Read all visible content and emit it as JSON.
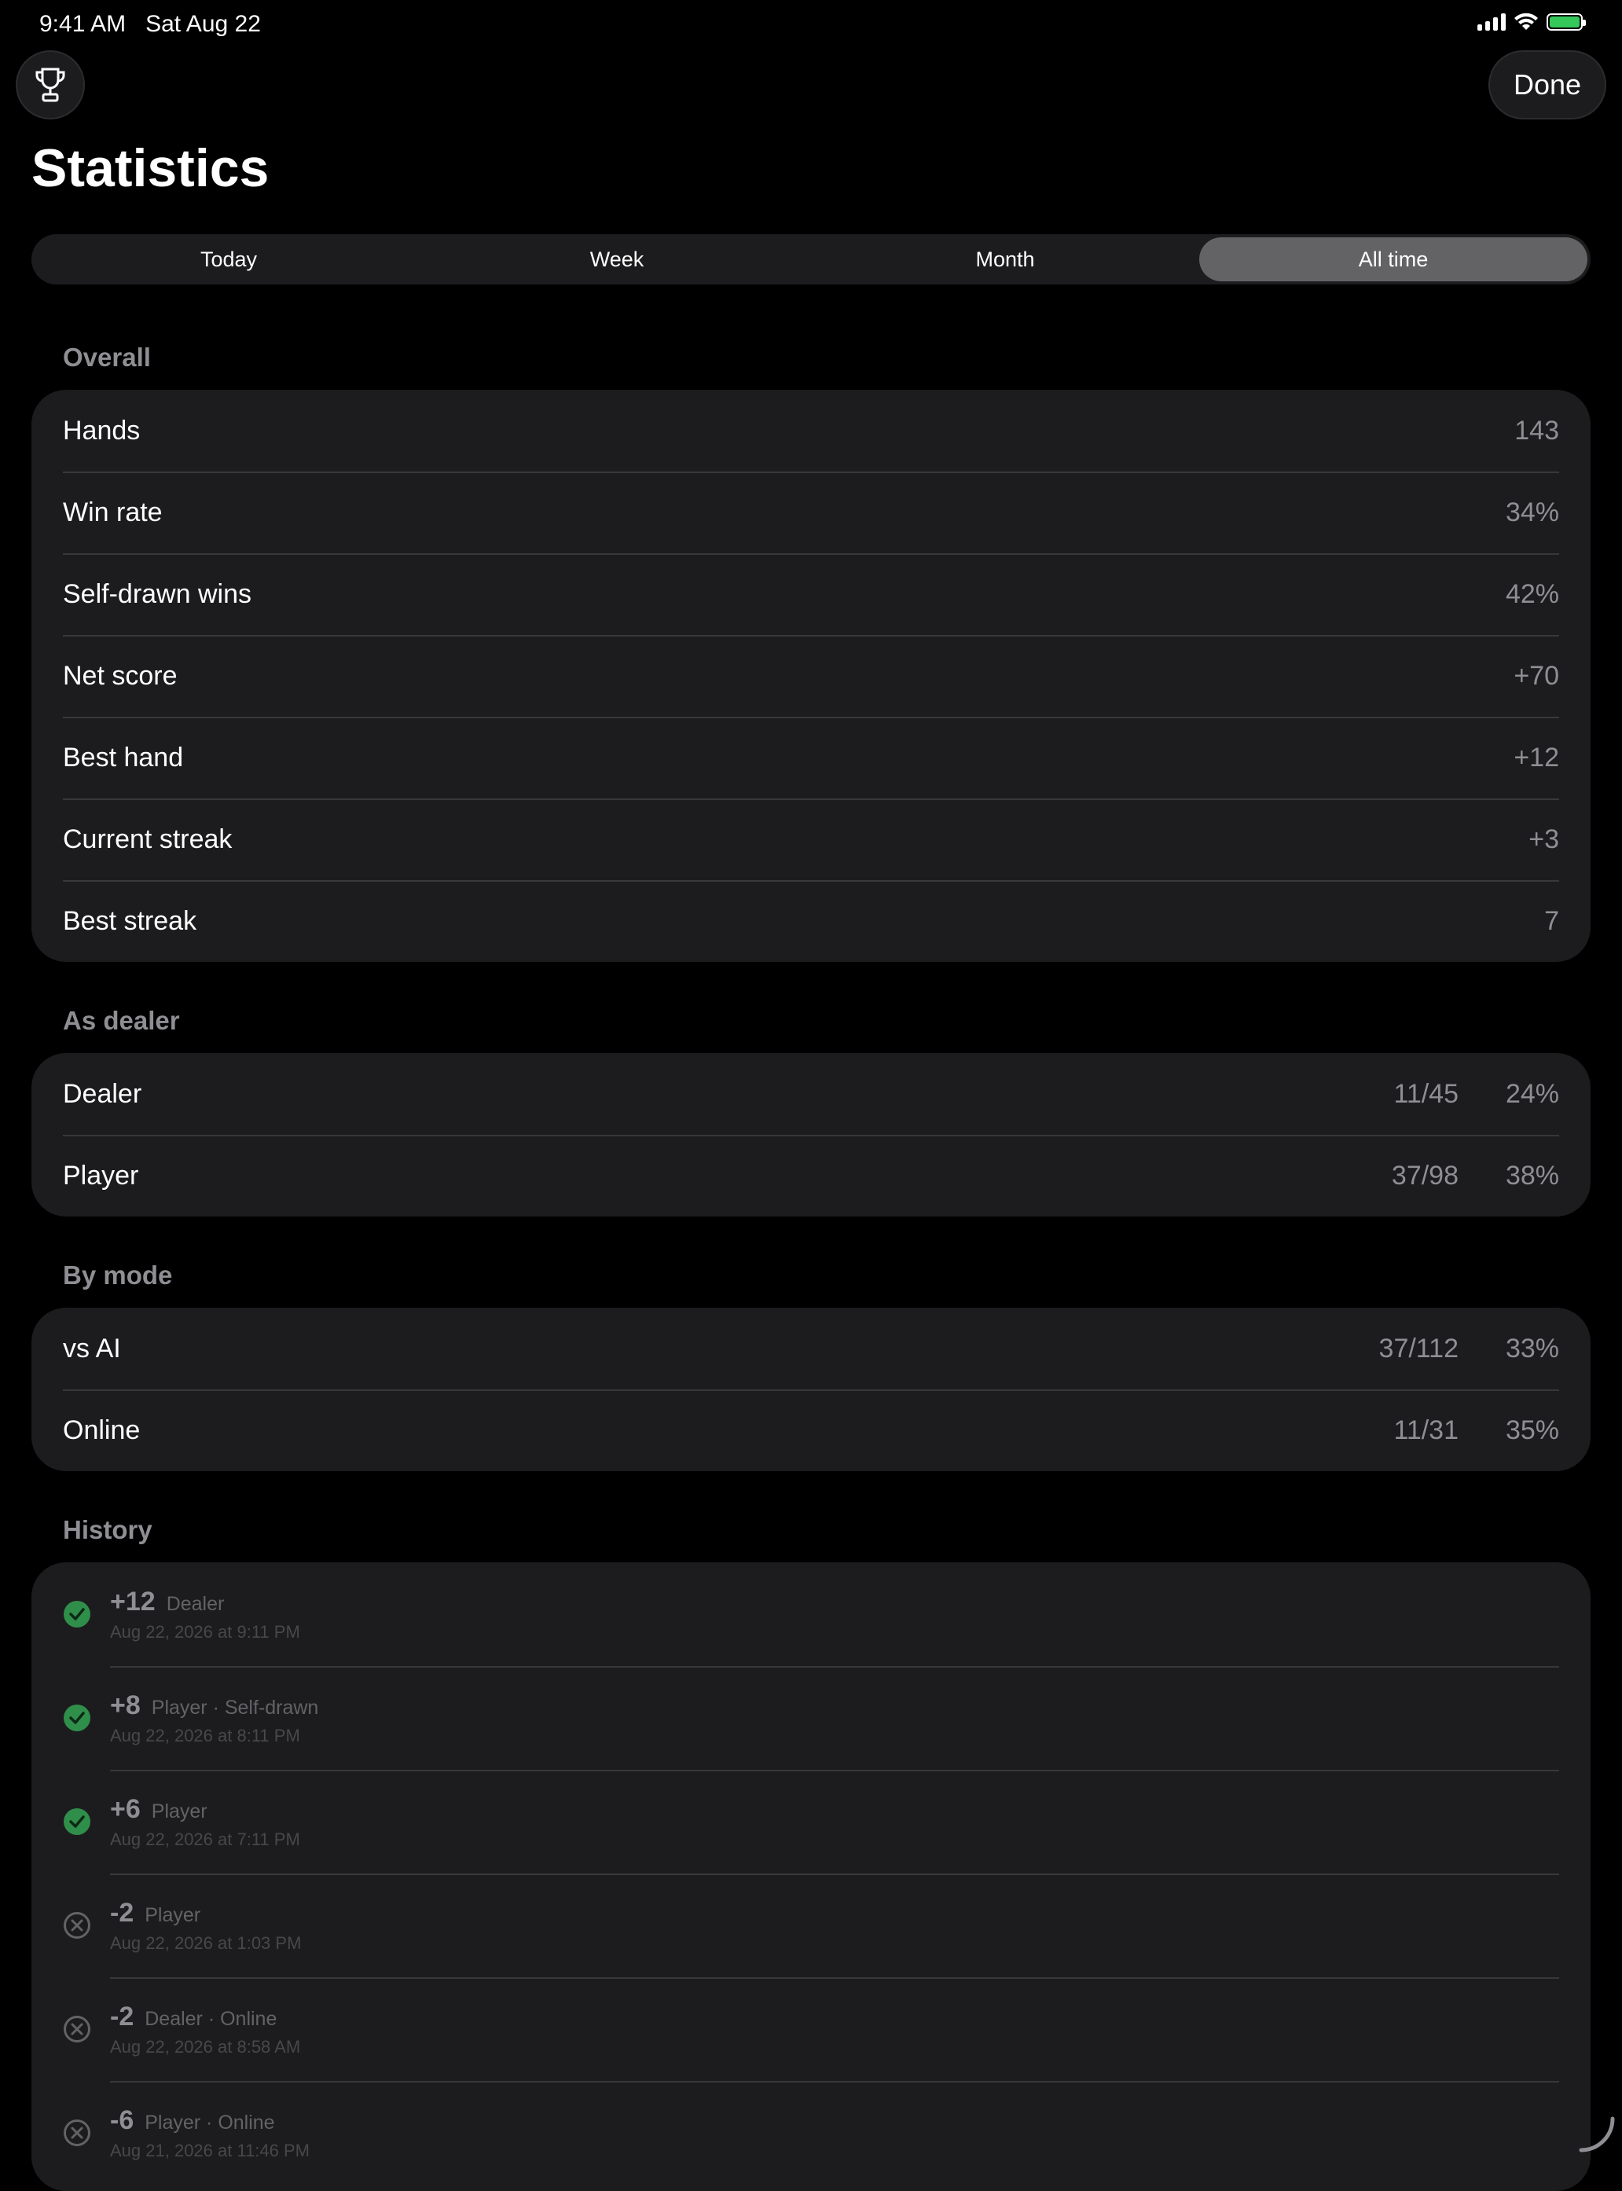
{
  "status_bar": {
    "time": "9:41 AM",
    "date": "Sat Aug 22"
  },
  "header": {
    "trophy_icon": "trophy-icon",
    "done_label": "Done",
    "title": "Statistics"
  },
  "tabs": [
    {
      "label": "Today",
      "active": false
    },
    {
      "label": "Week",
      "active": false
    },
    {
      "label": "Month",
      "active": false
    },
    {
      "label": "All time",
      "active": true
    }
  ],
  "overall": {
    "header": "Overall",
    "rows": [
      {
        "label": "Hands",
        "value": "143"
      },
      {
        "label": "Win rate",
        "value": "34%"
      },
      {
        "label": "Self-drawn wins",
        "value": "42%"
      },
      {
        "label": "Net score",
        "value": "+70"
      },
      {
        "label": "Best hand",
        "value": "+12"
      },
      {
        "label": "Current streak",
        "value": "+3"
      },
      {
        "label": "Best streak",
        "value": "7"
      }
    ]
  },
  "as_dealer": {
    "header": "As dealer",
    "rows": [
      {
        "label": "Dealer",
        "fraction": "11/45",
        "percent": "24%"
      },
      {
        "label": "Player",
        "fraction": "37/98",
        "percent": "38%"
      }
    ]
  },
  "by_mode": {
    "header": "By mode",
    "rows": [
      {
        "label": "vs AI",
        "fraction": "37/112",
        "percent": "33%"
      },
      {
        "label": "Online",
        "fraction": "11/31",
        "percent": "35%"
      }
    ]
  },
  "history": {
    "header": "History",
    "items": [
      {
        "score": "+12",
        "desc": "Dealer",
        "date": "Aug 22, 2026 at 9:11 PM",
        "win": true
      },
      {
        "score": "+8",
        "desc": "Player · Self-drawn",
        "date": "Aug 22, 2026 at 8:11 PM",
        "win": true
      },
      {
        "score": "+6",
        "desc": "Player",
        "date": "Aug 22, 2026 at 7:11 PM",
        "win": true
      },
      {
        "score": "-2",
        "desc": "Player",
        "date": "Aug 22, 2026 at 1:03 PM",
        "win": false
      },
      {
        "score": "-2",
        "desc": "Dealer · Online",
        "date": "Aug 22, 2026 at 8:58 AM",
        "win": false
      },
      {
        "score": "-6",
        "desc": "Player · Online",
        "date": "Aug 21, 2026 at 11:46 PM",
        "win": false
      }
    ]
  },
  "colors": {
    "win": "#30a14e",
    "loss": "#636366",
    "accent_active_tab": "#636366",
    "battery": "#34c759"
  }
}
